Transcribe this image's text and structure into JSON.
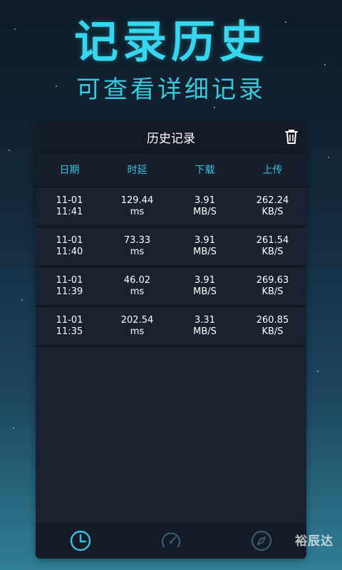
{
  "hero": {
    "title": "记录历史",
    "subtitle": "可查看详细记录"
  },
  "panel": {
    "title": "历史记录",
    "delete_icon": "trash-icon"
  },
  "table": {
    "headers": [
      "日期",
      "时延",
      "下载",
      "上传"
    ],
    "rows": [
      {
        "date": "11-01",
        "time": "11:41",
        "latency": "129.44",
        "latency_unit": "ms",
        "download": "3.91",
        "download_unit": "MB/S",
        "upload": "262.24",
        "upload_unit": "KB/S"
      },
      {
        "date": "11-01",
        "time": "11:40",
        "latency": "73.33",
        "latency_unit": "ms",
        "download": "3.91",
        "download_unit": "MB/S",
        "upload": "261.54",
        "upload_unit": "KB/S"
      },
      {
        "date": "11-01",
        "time": "11:39",
        "latency": "46.02",
        "latency_unit": "ms",
        "download": "3.91",
        "download_unit": "MB/S",
        "upload": "269.63",
        "upload_unit": "KB/S"
      },
      {
        "date": "11-01",
        "time": "11:35",
        "latency": "202.54",
        "latency_unit": "ms",
        "download": "3.31",
        "download_unit": "MB/S",
        "upload": "260.85",
        "upload_unit": "KB/S"
      }
    ]
  },
  "tabs": [
    {
      "icon": "clock-icon",
      "active": true
    },
    {
      "icon": "speedometer-icon",
      "active": false
    },
    {
      "icon": "compass-icon",
      "active": false
    }
  ],
  "watermark": "裕辰达",
  "colors": {
    "accent": "#36d6ef",
    "panel_bg": "#1a2230",
    "header_text": "#3cc1e0",
    "tab_active": "#3cc1e0",
    "tab_inactive": "#3a5a70"
  }
}
